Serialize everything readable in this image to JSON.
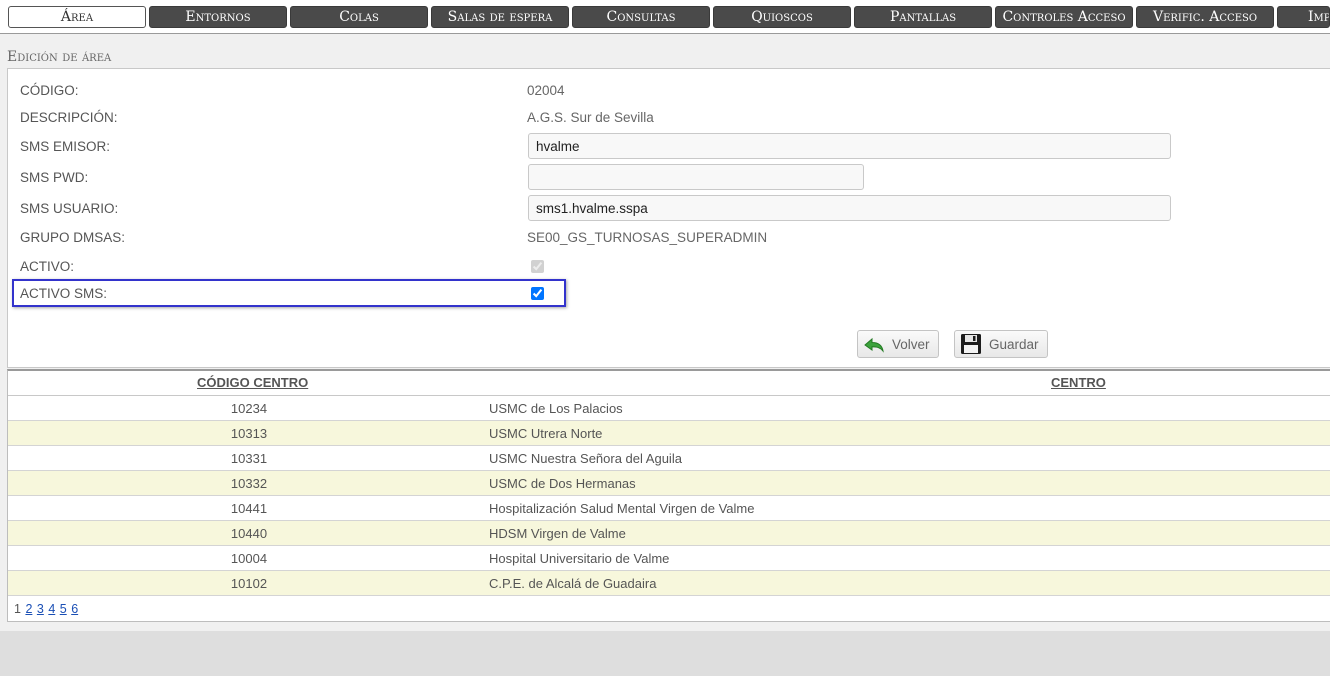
{
  "tabs": [
    {
      "label": "Área",
      "active": true
    },
    {
      "label": "Entornos"
    },
    {
      "label": "Colas"
    },
    {
      "label": "Salas de espera"
    },
    {
      "label": "Consultas"
    },
    {
      "label": "Quioscos"
    },
    {
      "label": "Pantallas"
    },
    {
      "label": "Controles Acceso"
    },
    {
      "label": "Verific. Acceso"
    },
    {
      "label": "Imp"
    }
  ],
  "section_title": "Edición de área",
  "form": {
    "codigo_label": "CÓDIGO:",
    "codigo_value": "02004",
    "descripcion_label": "DESCRIPCIÓN:",
    "descripcion_value": "A.G.S. Sur de Sevilla",
    "sms_emisor_label": "SMS EMISOR:",
    "sms_emisor_value": "hvalme",
    "sms_pwd_label": "SMS PWD:",
    "sms_pwd_value": "",
    "sms_usuario_label": "SMS USUARIO:",
    "sms_usuario_value": "sms1.hvalme.sspa",
    "grupo_label": "GRUPO DMSAS:",
    "grupo_value": "SE00_GS_TURNOSAS_SUPERADMIN",
    "activo_label": "ACTIVO:",
    "activo_checked": true,
    "activo_sms_label": "ACTIVO SMS:",
    "activo_sms_checked": true
  },
  "buttons": {
    "volver_label": "Volver",
    "guardar_label": "Guardar",
    "volver_icon": "back-arrow-icon",
    "guardar_icon": "floppy-disk-icon"
  },
  "table": {
    "headers": [
      "CÓDIGO CENTRO",
      "CENTRO"
    ],
    "rows": [
      [
        "10234",
        "USMC de Los Palacios"
      ],
      [
        "10313",
        "USMC Utrera Norte"
      ],
      [
        "10331",
        "USMC Nuestra Señora del Aguila"
      ],
      [
        "10332",
        "USMC de Dos Hermanas"
      ],
      [
        "10441",
        "Hospitalización Salud Mental Virgen de Valme"
      ],
      [
        "10440",
        "HDSM Virgen de Valme"
      ],
      [
        "10004",
        "Hospital Universitario de Valme"
      ],
      [
        "10102",
        "C.P.E. de Alcalá de Guadaira"
      ]
    ]
  },
  "pagination": {
    "current": "1",
    "pages": [
      "2",
      "3",
      "4",
      "5",
      "6"
    ]
  },
  "colors": {
    "tab_bg": "#4a4a4a",
    "row_alt": "#f7f7dc",
    "focus_border": "#3333cc",
    "link": "#1a4fb5"
  }
}
